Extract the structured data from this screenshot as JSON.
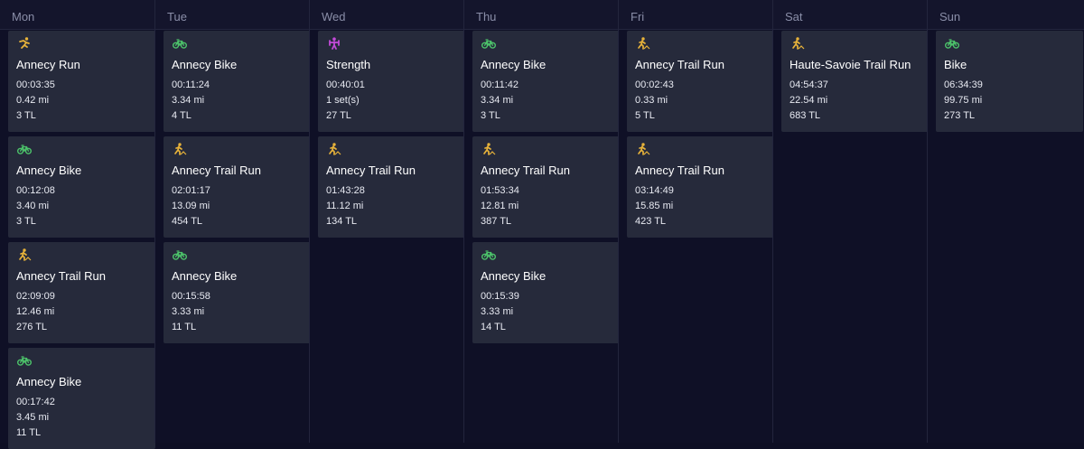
{
  "days": [
    {
      "label": "Mon",
      "workouts": [
        {
          "type": "run",
          "icon": "running-icon",
          "title": "Annecy Run",
          "duration": "00:03:35",
          "distance": "0.42 mi",
          "load": "3 TL"
        },
        {
          "type": "bike",
          "icon": "bike-icon",
          "title": "Annecy Bike",
          "duration": "00:12:08",
          "distance": "3.40 mi",
          "load": "3 TL"
        },
        {
          "type": "trail",
          "icon": "trail-run-icon",
          "title": "Annecy Trail Run",
          "duration": "02:09:09",
          "distance": "12.46 mi",
          "load": "276 TL"
        },
        {
          "type": "bike",
          "icon": "bike-icon",
          "title": "Annecy Bike",
          "duration": "00:17:42",
          "distance": "3.45 mi",
          "load": "11 TL"
        }
      ]
    },
    {
      "label": "Tue",
      "workouts": [
        {
          "type": "bike",
          "icon": "bike-icon",
          "title": "Annecy Bike",
          "duration": "00:11:24",
          "distance": "3.34 mi",
          "load": "4 TL"
        },
        {
          "type": "trail",
          "icon": "trail-run-icon",
          "title": "Annecy Trail Run",
          "duration": "02:01:17",
          "distance": "13.09 mi",
          "load": "454 TL"
        },
        {
          "type": "bike",
          "icon": "bike-icon",
          "title": "Annecy Bike",
          "duration": "00:15:58",
          "distance": "3.33 mi",
          "load": "11 TL"
        }
      ]
    },
    {
      "label": "Wed",
      "workouts": [
        {
          "type": "strength",
          "icon": "strength-icon",
          "title": "Strength",
          "duration": "00:40:01",
          "distance": "1 set(s)",
          "load": "27 TL"
        },
        {
          "type": "trail",
          "icon": "trail-run-icon",
          "title": "Annecy Trail Run",
          "duration": "01:43:28",
          "distance": "11.12 mi",
          "load": "134 TL"
        }
      ]
    },
    {
      "label": "Thu",
      "workouts": [
        {
          "type": "bike",
          "icon": "bike-icon",
          "title": "Annecy Bike",
          "duration": "00:11:42",
          "distance": "3.34 mi",
          "load": "3 TL"
        },
        {
          "type": "trail",
          "icon": "trail-run-icon",
          "title": "Annecy Trail Run",
          "duration": "01:53:34",
          "distance": "12.81 mi",
          "load": "387 TL"
        },
        {
          "type": "bike",
          "icon": "bike-icon",
          "title": "Annecy Bike",
          "duration": "00:15:39",
          "distance": "3.33 mi",
          "load": "14 TL"
        }
      ]
    },
    {
      "label": "Fri",
      "workouts": [
        {
          "type": "trail",
          "icon": "trail-run-icon",
          "title": "Annecy Trail Run",
          "duration": "00:02:43",
          "distance": "0.33 mi",
          "load": "5 TL"
        },
        {
          "type": "trail",
          "icon": "trail-run-icon",
          "title": "Annecy Trail Run",
          "duration": "03:14:49",
          "distance": "15.85 mi",
          "load": "423 TL"
        }
      ]
    },
    {
      "label": "Sat",
      "workouts": [
        {
          "type": "trail",
          "icon": "trail-run-icon",
          "title": "Haute-Savoie Trail Run",
          "duration": "04:54:37",
          "distance": "22.54 mi",
          "load": "683 TL"
        }
      ]
    },
    {
      "label": "Sun",
      "workouts": [
        {
          "type": "bike",
          "icon": "bike-icon",
          "title": "Bike",
          "duration": "06:34:39",
          "distance": "99.75 mi",
          "load": "273 TL"
        }
      ]
    }
  ],
  "colors": {
    "run": "#e8b33a",
    "bike": "#4cc26a",
    "strength": "#c24ad8"
  }
}
